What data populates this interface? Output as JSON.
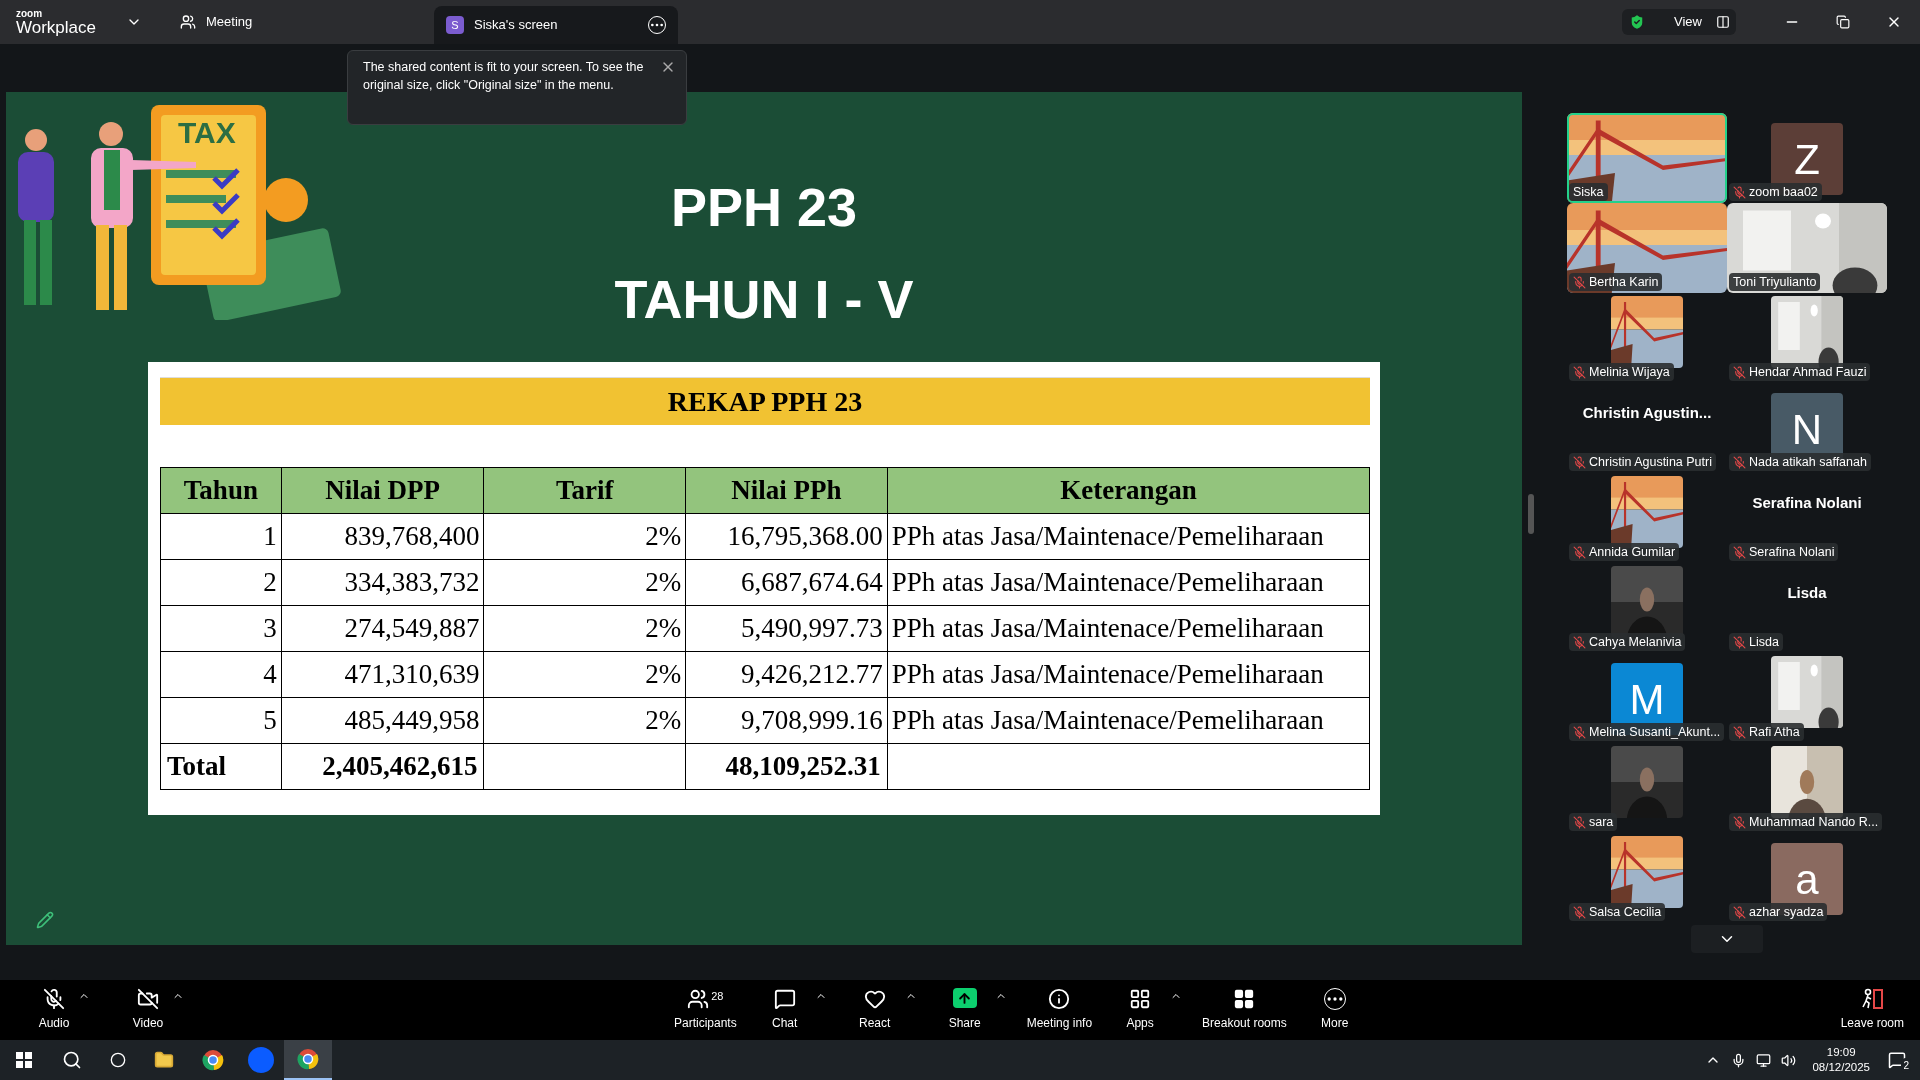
{
  "app": {
    "logo_top": "zoom",
    "logo_bottom": "Workplace"
  },
  "tabs": [
    {
      "label": "Meeting",
      "selected": false
    },
    {
      "label": "Siska's screen",
      "badge": "S",
      "selected": true
    }
  ],
  "view_button": "View",
  "notice": "The shared content is fit to your screen. To see the original size, click \"Original size\" in the menu.",
  "slide": {
    "title": "PPH 23",
    "subtitle": "TAHUN I - V",
    "illustration_label": "TAX",
    "table": {
      "title": "REKAP PPH 23",
      "columns": [
        "Tahun",
        "Nilai DPP",
        "Tarif",
        "Nilai PPh",
        "Keterangan"
      ],
      "rows": [
        [
          "1",
          "839,768,400",
          "2%",
          "16,795,368.00",
          "PPh atas Jasa/Maintenace/Pemeliharaan"
        ],
        [
          "2",
          "334,383,732",
          "2%",
          "6,687,674.64",
          "PPh atas Jasa/Maintenace/Pemeliharaan"
        ],
        [
          "3",
          "274,549,887",
          "2%",
          "5,490,997.73",
          "PPh atas Jasa/Maintenace/Pemeliharaan"
        ],
        [
          "4",
          "471,310,639",
          "2%",
          "9,426,212.77",
          "PPh atas Jasa/Maintenace/Pemeliharaan"
        ],
        [
          "5",
          "485,449,958",
          "2%",
          "9,708,999.16",
          "PPh atas Jasa/Maintenace/Pemeliharaan"
        ]
      ],
      "total": [
        "Total",
        "2,405,462,615",
        "48,109,252.31"
      ]
    }
  },
  "participants": [
    {
      "kind": "video",
      "name": "Siska",
      "muted": false,
      "speaking": true
    },
    {
      "kind": "letter",
      "display": "Z",
      "color": "#5c3e37",
      "name": "zoom baa02",
      "muted": true,
      "speaking": false
    },
    {
      "kind": "video",
      "name": "Bertha Karin",
      "muted": true,
      "speaking": false
    },
    {
      "kind": "video",
      "name": "Toni Triyulianto",
      "muted": false,
      "speaking": false
    },
    {
      "kind": "picture",
      "name": "Melinia Wijaya",
      "muted": true,
      "speaking": false
    },
    {
      "kind": "picture",
      "name": "Hendar Ahmad Fauzi",
      "muted": true,
      "speaking": false
    },
    {
      "kind": "name",
      "display": "Christin  Agustin...",
      "name": "Christin Agustina Putri",
      "muted": true,
      "speaking": false
    },
    {
      "kind": "letter",
      "display": "N",
      "color": "#485a66",
      "name": "Nada atikah saffanah",
      "muted": true,
      "speaking": false
    },
    {
      "kind": "picture",
      "name": "Annida Gumilar",
      "muted": true,
      "speaking": false
    },
    {
      "kind": "name",
      "display": "Serafina Nolani",
      "name": "Serafina Nolani",
      "muted": true,
      "speaking": false
    },
    {
      "kind": "picture",
      "name": "Cahya Melanivia",
      "muted": true,
      "speaking": false
    },
    {
      "kind": "name",
      "display": "Lisda",
      "name": "Lisda",
      "muted": true,
      "speaking": false
    },
    {
      "kind": "letter",
      "display": "M",
      "color": "#0b88d4",
      "name": "Melina Susanti_Akunt...",
      "muted": true,
      "speaking": false
    },
    {
      "kind": "picture",
      "name": "Rafi Atha",
      "muted": true,
      "speaking": false
    },
    {
      "kind": "picture",
      "name": "sara",
      "muted": true,
      "speaking": false
    },
    {
      "kind": "picture",
      "name": "Muhammad Nando R...",
      "muted": true,
      "speaking": false
    },
    {
      "kind": "picture",
      "name": "Salsa Cecilia",
      "muted": true,
      "speaking": false
    },
    {
      "kind": "letter",
      "display": "a",
      "color": "#8a6a60",
      "name": "azhar syadza",
      "muted": true,
      "speaking": false
    }
  ],
  "toolbar_left": [
    {
      "kind": "audio",
      "label": "Audio"
    },
    {
      "kind": "video",
      "label": "Video"
    }
  ],
  "toolbar_center": [
    {
      "kind": "participants",
      "label": "Participants",
      "count": "28",
      "caret": false
    },
    {
      "kind": "chat",
      "label": "Chat",
      "caret": true
    },
    {
      "kind": "react",
      "label": "React",
      "caret": true
    },
    {
      "kind": "share",
      "label": "Share",
      "caret": true
    },
    {
      "kind": "info",
      "label": "Meeting info",
      "caret": false
    },
    {
      "kind": "apps",
      "label": "Apps",
      "caret": true
    },
    {
      "kind": "breakout",
      "label": "Breakout rooms",
      "caret": false
    },
    {
      "kind": "more",
      "label": "More",
      "caret": false
    }
  ],
  "leave_button": "Leave room",
  "taskbar": {
    "time": "19:09",
    "date": "08/12/2025",
    "notifications": "2"
  }
}
